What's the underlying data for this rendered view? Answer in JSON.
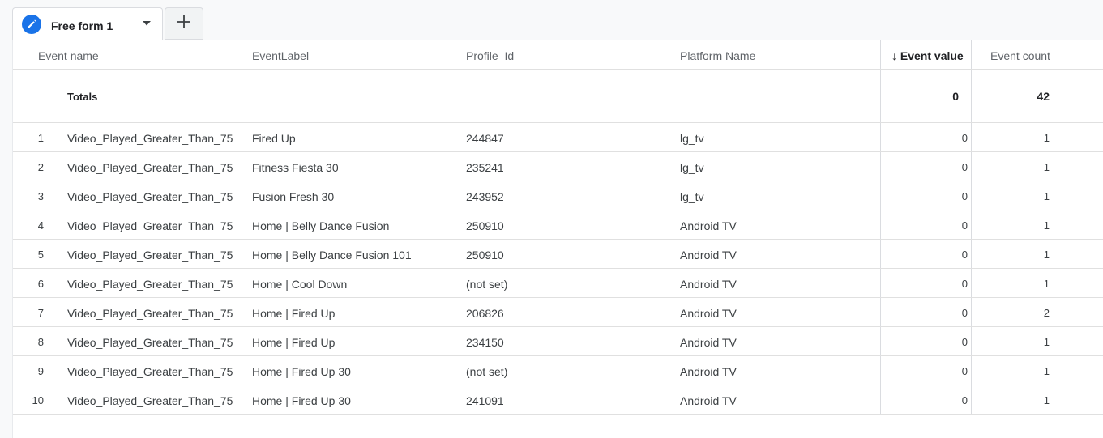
{
  "tabs": [
    {
      "label": "Free form 1",
      "icon": "pencil-icon",
      "active": true
    }
  ],
  "add_tab_icon": "plus-icon",
  "colors": {
    "accent": "#1a73e8",
    "divider": "#e0e0e0",
    "header_text": "#5f6368"
  },
  "table": {
    "columns": [
      {
        "label": "Event name"
      },
      {
        "label": "EventLabel"
      },
      {
        "label": "Profile_Id"
      },
      {
        "label": "Platform Name"
      },
      {
        "label": "Event value",
        "sorted": "descending"
      },
      {
        "label": "Event count"
      }
    ],
    "sort_arrow": "↓",
    "totals": {
      "label": "Totals",
      "event_value": "0",
      "event_count": "42"
    },
    "rows": [
      {
        "index": "1",
        "event_name": "Video_Played_Greater_Than_75",
        "event_label": "Fired Up",
        "profile_id": "244847",
        "platform": "lg_tv",
        "event_value": "0",
        "event_count": "1"
      },
      {
        "index": "2",
        "event_name": "Video_Played_Greater_Than_75",
        "event_label": "Fitness Fiesta 30",
        "profile_id": "235241",
        "platform": "lg_tv",
        "event_value": "0",
        "event_count": "1"
      },
      {
        "index": "3",
        "event_name": "Video_Played_Greater_Than_75",
        "event_label": "Fusion Fresh 30",
        "profile_id": "243952",
        "platform": "lg_tv",
        "event_value": "0",
        "event_count": "1"
      },
      {
        "index": "4",
        "event_name": "Video_Played_Greater_Than_75",
        "event_label": "Home | Belly Dance Fusion",
        "profile_id": "250910",
        "platform": "Android TV",
        "event_value": "0",
        "event_count": "1"
      },
      {
        "index": "5",
        "event_name": "Video_Played_Greater_Than_75",
        "event_label": "Home | Belly Dance Fusion 101",
        "profile_id": "250910",
        "platform": "Android TV",
        "event_value": "0",
        "event_count": "1"
      },
      {
        "index": "6",
        "event_name": "Video_Played_Greater_Than_75",
        "event_label": "Home | Cool Down",
        "profile_id": "(not set)",
        "platform": "Android TV",
        "event_value": "0",
        "event_count": "1"
      },
      {
        "index": "7",
        "event_name": "Video_Played_Greater_Than_75",
        "event_label": "Home | Fired Up",
        "profile_id": "206826",
        "platform": "Android TV",
        "event_value": "0",
        "event_count": "2"
      },
      {
        "index": "8",
        "event_name": "Video_Played_Greater_Than_75",
        "event_label": "Home | Fired Up",
        "profile_id": "234150",
        "platform": "Android TV",
        "event_value": "0",
        "event_count": "1"
      },
      {
        "index": "9",
        "event_name": "Video_Played_Greater_Than_75",
        "event_label": "Home | Fired Up 30",
        "profile_id": "(not set)",
        "platform": "Android TV",
        "event_value": "0",
        "event_count": "1"
      },
      {
        "index": "10",
        "event_name": "Video_Played_Greater_Than_75",
        "event_label": "Home | Fired Up 30",
        "profile_id": "241091",
        "platform": "Android TV",
        "event_value": "0",
        "event_count": "1"
      }
    ]
  }
}
